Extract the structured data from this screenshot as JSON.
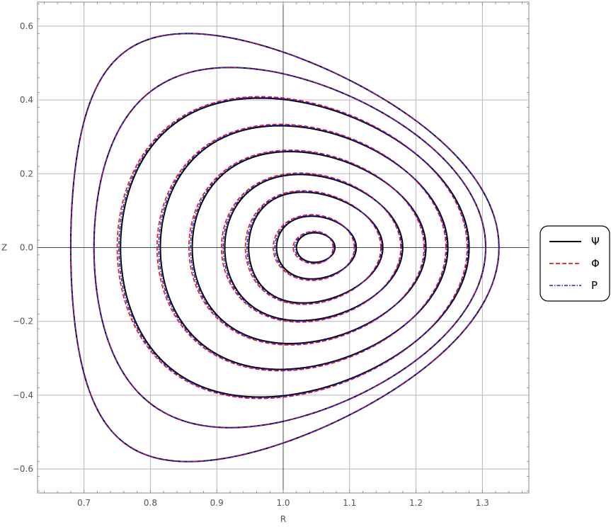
{
  "chart_data": {
    "type": "line",
    "title": "",
    "xlabel": "R",
    "ylabel": "Z",
    "xlim": [
      0.63,
      1.37
    ],
    "ylim": [
      -0.665,
      0.665
    ],
    "xticks": [
      0.7,
      0.8,
      0.9,
      1.0,
      1.1,
      1.2,
      1.3
    ],
    "xtick_labels": [
      "0.7",
      "0.8",
      "0.9",
      "1.0",
      "1.1",
      "1.2",
      "1.3"
    ],
    "yticks": [
      0.6,
      0.4,
      0.2,
      0.0,
      -0.2,
      -0.4,
      -0.6
    ],
    "ytick_labels": [
      "0.6",
      "0.4",
      "0.2",
      "0.0",
      "−0.2",
      "−0.4",
      "−0.6"
    ],
    "grid": true,
    "legend_position": "right",
    "series": [
      {
        "name": "Ψ",
        "color": "#000000",
        "style": "solid"
      },
      {
        "name": "Φ",
        "color": "#e41a1c",
        "style": "dashed"
      },
      {
        "name": "P",
        "color": "#1f1fd6",
        "style": "dashdot"
      }
    ],
    "contours": [
      {
        "r_min": 1.02,
        "r_max": 1.078,
        "z_max": 0.04,
        "r_top": 1.047
      },
      {
        "r_min": 0.99,
        "r_max": 1.11,
        "z_max": 0.085,
        "r_top": 1.043
      },
      {
        "r_min": 0.948,
        "r_max": 1.15,
        "z_max": 0.15,
        "r_top": 1.03
      },
      {
        "r_min": 0.912,
        "r_max": 1.18,
        "z_max": 0.198,
        "r_top": 1.025
      },
      {
        "r_min": 0.863,
        "r_max": 1.215,
        "z_max": 0.26,
        "r_top": 1.01
      },
      {
        "r_min": 0.815,
        "r_max": 1.248,
        "z_max": 0.33,
        "r_top": 0.995
      },
      {
        "r_min": 0.755,
        "r_max": 1.28,
        "z_max": 0.405,
        "r_top": 0.965
      },
      {
        "r_min": 0.715,
        "r_max": 1.305,
        "z_max": 0.488,
        "r_top": 0.92
      },
      {
        "r_min": 0.68,
        "r_max": 1.325,
        "z_max": 0.58,
        "r_top": 0.857
      }
    ]
  }
}
